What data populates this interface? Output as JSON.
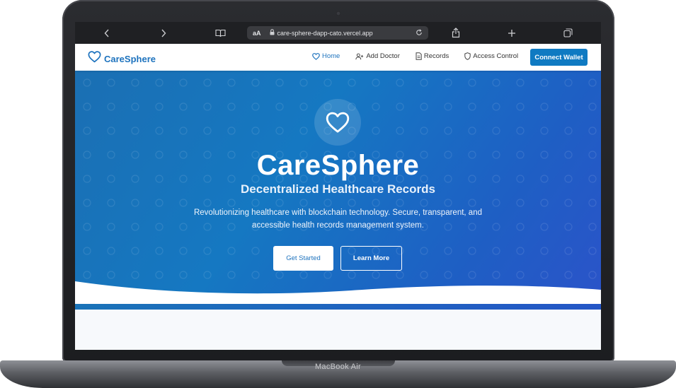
{
  "device": {
    "label": "MacBook Air"
  },
  "browser": {
    "url_prefix": "aA",
    "url": "care-sphere-dapp-cato.vercel.app",
    "icons": [
      "back-icon",
      "forward-icon",
      "book-icon",
      "lock-icon",
      "reload-icon",
      "share-icon",
      "plus-icon",
      "tabs-icon"
    ]
  },
  "nav": {
    "brand": "CareSphere",
    "links": [
      {
        "label": "Home",
        "icon": "heart-icon",
        "active": true
      },
      {
        "label": "Add Doctor",
        "icon": "user-plus-icon",
        "active": false
      },
      {
        "label": "Records",
        "icon": "document-icon",
        "active": false
      },
      {
        "label": "Access Control",
        "icon": "shield-icon",
        "active": false
      }
    ],
    "cta": "Connect Wallet"
  },
  "hero": {
    "title": "CareSphere",
    "subtitle": "Decentralized Healthcare Records",
    "description": "Revolutionizing healthcare with blockchain technology. Secure, transparent, and accessible health records management system.",
    "primary_button": "Get Started",
    "secondary_button": "Learn More"
  },
  "colors": {
    "brand": "#1e73be",
    "cta": "#0f7ac2",
    "hero_start": "#1b6fb3",
    "hero_end": "#2b53c9"
  }
}
